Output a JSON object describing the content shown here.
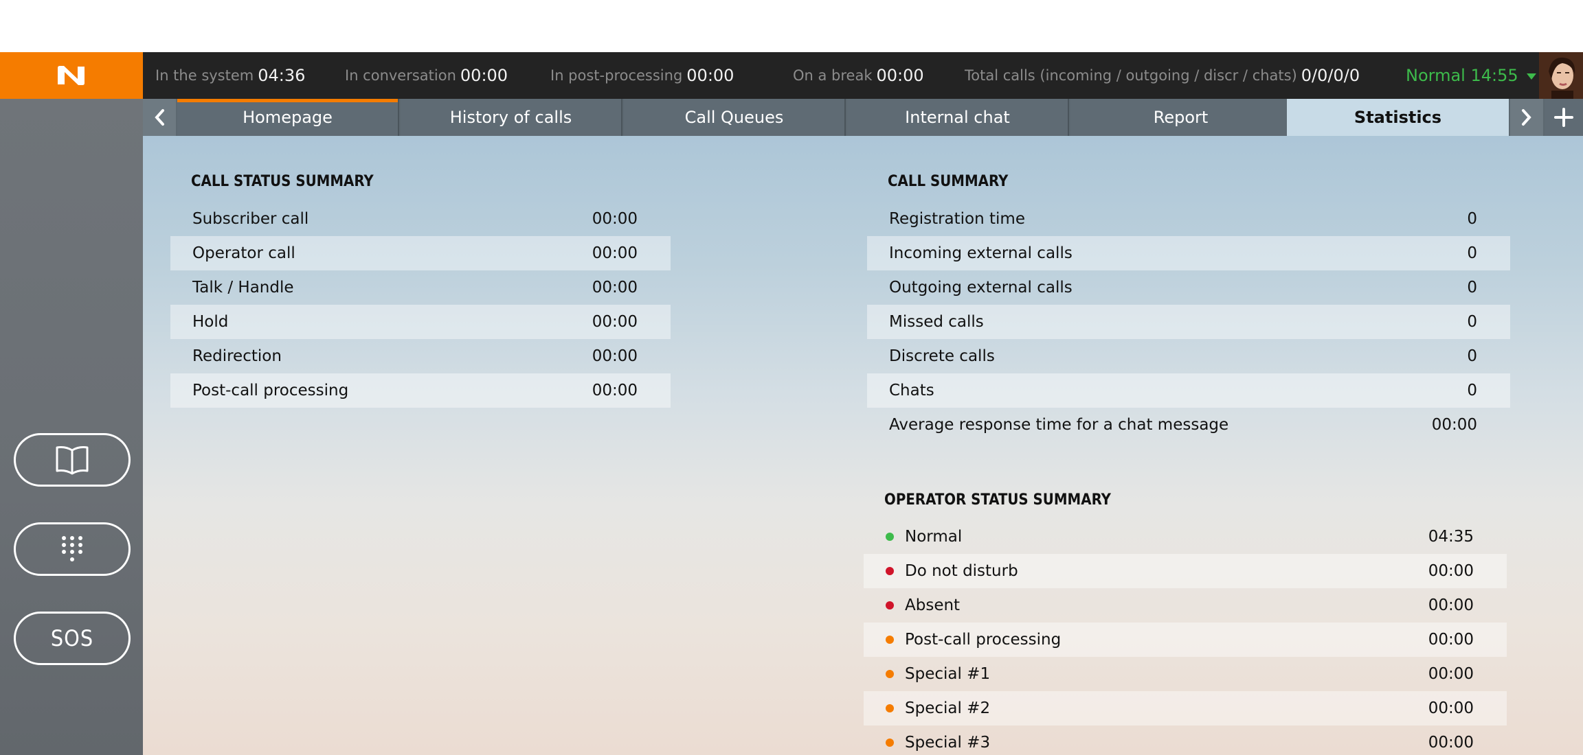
{
  "topbar": {
    "in_system": {
      "label": "In the system",
      "value": "04:36"
    },
    "in_conversation": {
      "label": "In conversation",
      "value": "00:00"
    },
    "post_processing": {
      "label": "In post-processing",
      "value": "00:00"
    },
    "on_break": {
      "label": "On a break",
      "value": "00:00"
    },
    "total_calls": {
      "label": "Total calls (incoming / outgoing / discr / chats)",
      "value": "0/0/0/0"
    },
    "status": {
      "label": "Normal 14:55",
      "color": "#3dbb4b"
    }
  },
  "tabs": [
    {
      "label": "Homepage",
      "active": false,
      "highlight": true
    },
    {
      "label": "History of calls",
      "active": false
    },
    {
      "label": "Call Queues",
      "active": false
    },
    {
      "label": "Internal chat",
      "active": false
    },
    {
      "label": "Report",
      "active": false
    },
    {
      "label": "Statistics",
      "active": true
    }
  ],
  "sidebar": {
    "buttons": [
      {
        "name": "phonebook-button",
        "icon": "book-icon"
      },
      {
        "name": "dialpad-button",
        "icon": "dialpad-icon"
      },
      {
        "name": "sos-button",
        "label": "SOS"
      }
    ]
  },
  "call_status_summary": {
    "title": "CALL STATUS SUMMARY",
    "rows": [
      {
        "name": "Subscriber call",
        "value": "00:00"
      },
      {
        "name": "Operator call",
        "value": "00:00"
      },
      {
        "name": "Talk / Handle",
        "value": "00:00"
      },
      {
        "name": "Hold",
        "value": "00:00"
      },
      {
        "name": "Redirection",
        "value": "00:00"
      },
      {
        "name": "Post-call processing",
        "value": "00:00"
      }
    ]
  },
  "call_summary": {
    "title": "CALL SUMMARY",
    "rows": [
      {
        "name": "Registration time",
        "value": "0"
      },
      {
        "name": "Incoming external calls",
        "value": "0"
      },
      {
        "name": "Outgoing external calls",
        "value": "0"
      },
      {
        "name": "Missed calls",
        "value": "0"
      },
      {
        "name": "Discrete calls",
        "value": "0"
      },
      {
        "name": "Chats",
        "value": "0"
      },
      {
        "name": "Average response time for a chat message",
        "value": "00:00"
      }
    ]
  },
  "operator_status_summary": {
    "title": "OPERATOR STATUS SUMMARY",
    "rows": [
      {
        "name": "Normal",
        "value": "04:35",
        "color": "#3dbb4b"
      },
      {
        "name": "Do not disturb",
        "value": "00:00",
        "color": "#d0142a"
      },
      {
        "name": "Absent",
        "value": "00:00",
        "color": "#d0142a"
      },
      {
        "name": "Post-call processing",
        "value": "00:00",
        "color": "#f57c00"
      },
      {
        "name": "Special #1",
        "value": "00:00",
        "color": "#f57c00"
      },
      {
        "name": "Special #2",
        "value": "00:00",
        "color": "#f57c00"
      },
      {
        "name": "Special #3",
        "value": "00:00",
        "color": "#f57c00"
      }
    ]
  }
}
